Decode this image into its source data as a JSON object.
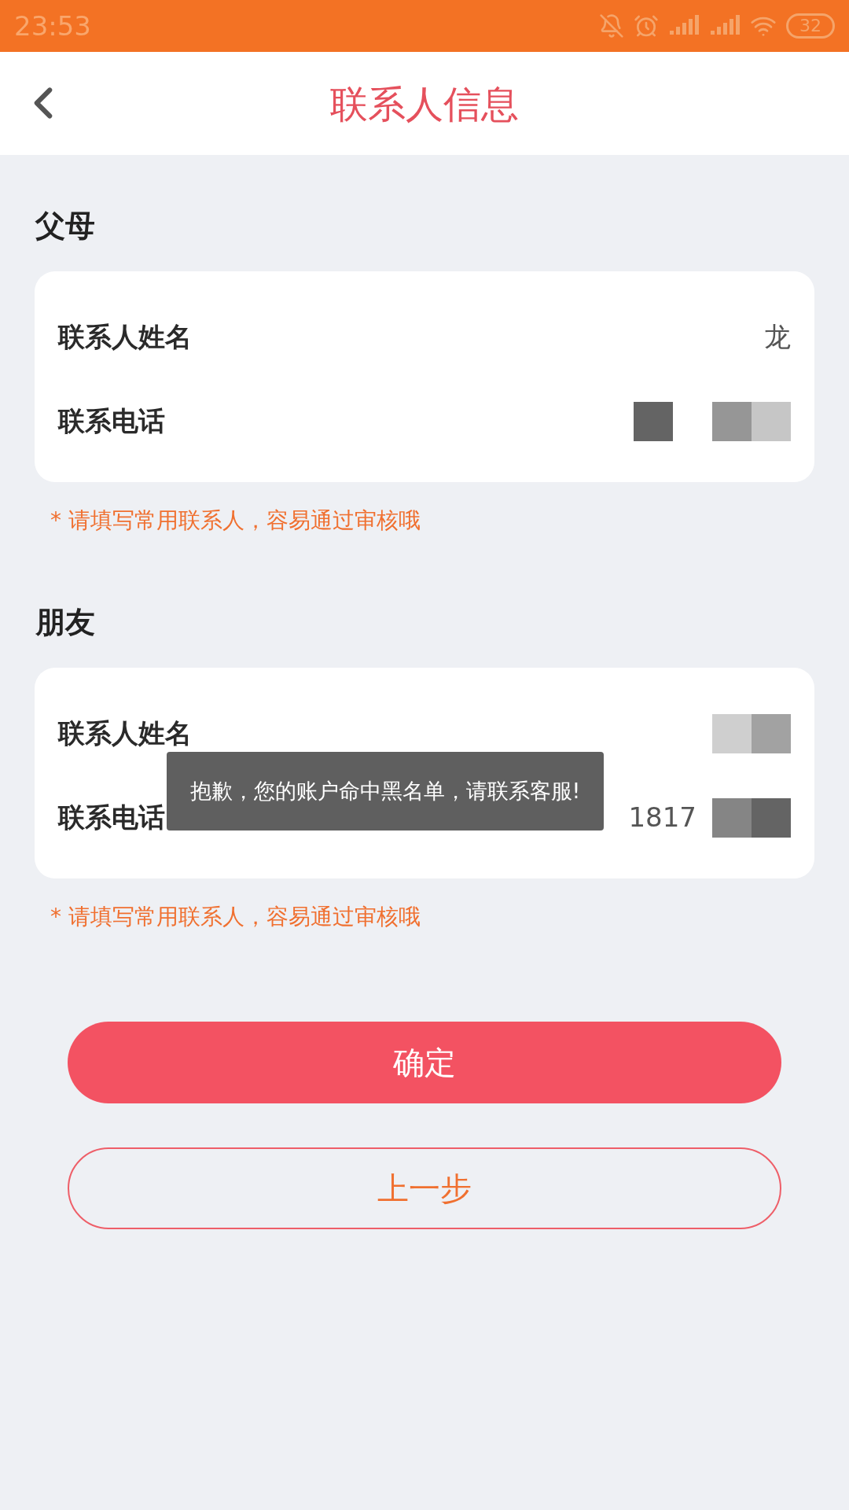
{
  "status_bar": {
    "time": "23:53",
    "battery": "32"
  },
  "header": {
    "title": "联系人信息"
  },
  "sections": [
    {
      "title": "父母",
      "rows": [
        {
          "label": "联系人姓名",
          "value": "龙"
        },
        {
          "label": "联系电话"
        }
      ],
      "hint": "* 请填写常用联系人，容易通过审核哦"
    },
    {
      "title": "朋友",
      "rows": [
        {
          "label": "联系人姓名"
        },
        {
          "label": "联系电话",
          "value": "1817"
        }
      ],
      "hint": "* 请填写常用联系人，容易通过审核哦"
    }
  ],
  "toast": "抱歉，您的账户命中黑名单，请联系客服!",
  "buttons": [
    {
      "label": "确定",
      "kind": "primary"
    },
    {
      "label": "上一步",
      "kind": "outline"
    }
  ]
}
